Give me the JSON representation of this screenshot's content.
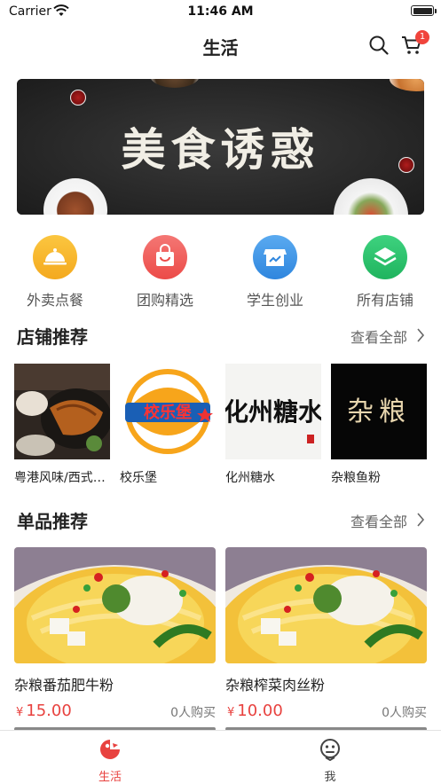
{
  "status_bar": {
    "carrier": "Carrier",
    "time": "11:46 AM"
  },
  "nav": {
    "title": "生活",
    "cart_badge": "1"
  },
  "banner": {
    "headline": "美食诱惑"
  },
  "categories": [
    {
      "label": "外卖点餐",
      "icon": "food-cloche-icon",
      "color": "#f8b92d"
    },
    {
      "label": "团购精选",
      "icon": "shopping-bag-icon",
      "color": "#f05b58"
    },
    {
      "label": "学生创业",
      "icon": "storefront-icon",
      "color": "#3b95e8"
    },
    {
      "label": "所有店铺",
      "icon": "layers-icon",
      "color": "#2fc06f"
    }
  ],
  "stores_section": {
    "title": "店铺推荐",
    "more": "查看全部"
  },
  "stores": [
    {
      "name": "粤港风味/西式简餐"
    },
    {
      "name": "校乐堡",
      "logo_text": "校乐堡"
    },
    {
      "name": "化州糖水",
      "logo_text": "化州糖水"
    },
    {
      "name": "杂粮鱼粉",
      "logo_text": "杂粮"
    }
  ],
  "products_section": {
    "title": "单品推荐",
    "more": "查看全部"
  },
  "products": [
    {
      "name": "杂粮番茄肥牛粉",
      "currency": "¥",
      "price": "15.00",
      "bought": "0人购买"
    },
    {
      "name": "杂粮榨菜肉丝粉",
      "currency": "¥",
      "price": "10.00",
      "bought": "0人购买"
    }
  ],
  "tabbar": [
    {
      "label": "生活",
      "active": true,
      "icon": "life-icon"
    },
    {
      "label": "我",
      "active": false,
      "icon": "profile-icon"
    }
  ],
  "colors": {
    "accent": "#e8423f",
    "tab_inactive": "#555555"
  }
}
